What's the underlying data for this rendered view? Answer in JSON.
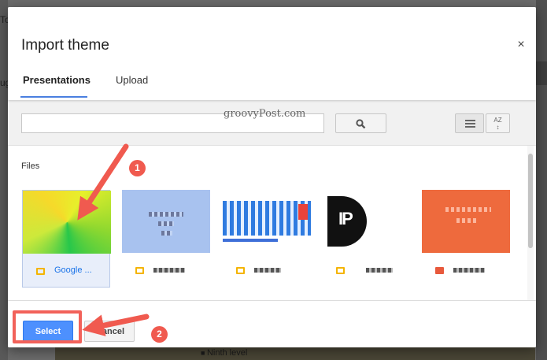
{
  "background": {
    "left_text_top": "To",
    "left_text_mid": "ug",
    "bottom_text": "Ninth level"
  },
  "dialog": {
    "title": "Import theme",
    "close_label": "×",
    "tabs": [
      {
        "label": "Presentations",
        "active": true
      },
      {
        "label": "Upload",
        "active": false
      }
    ],
    "search": {
      "value": "",
      "placeholder": ""
    },
    "files_label": "Files",
    "files": [
      {
        "name": "Google ...",
        "type": "slides",
        "selected": true
      },
      {
        "name": "",
        "type": "slides",
        "selected": false
      },
      {
        "name": "",
        "type": "slides",
        "selected": false
      },
      {
        "name": "",
        "type": "slides",
        "selected": false
      },
      {
        "name": "",
        "type": "powerpoint",
        "selected": false
      }
    ],
    "sort_label": "AZ",
    "select_label": "Select",
    "cancel_label": "Cancel"
  },
  "watermark": "groovyPost.com",
  "annotations": {
    "step1": "1",
    "step2": "2",
    "color": "#f05a4f"
  },
  "colors": {
    "accent": "#4d90fe",
    "tab_underline": "#4a7fe0",
    "annotation": "#f2625a"
  }
}
